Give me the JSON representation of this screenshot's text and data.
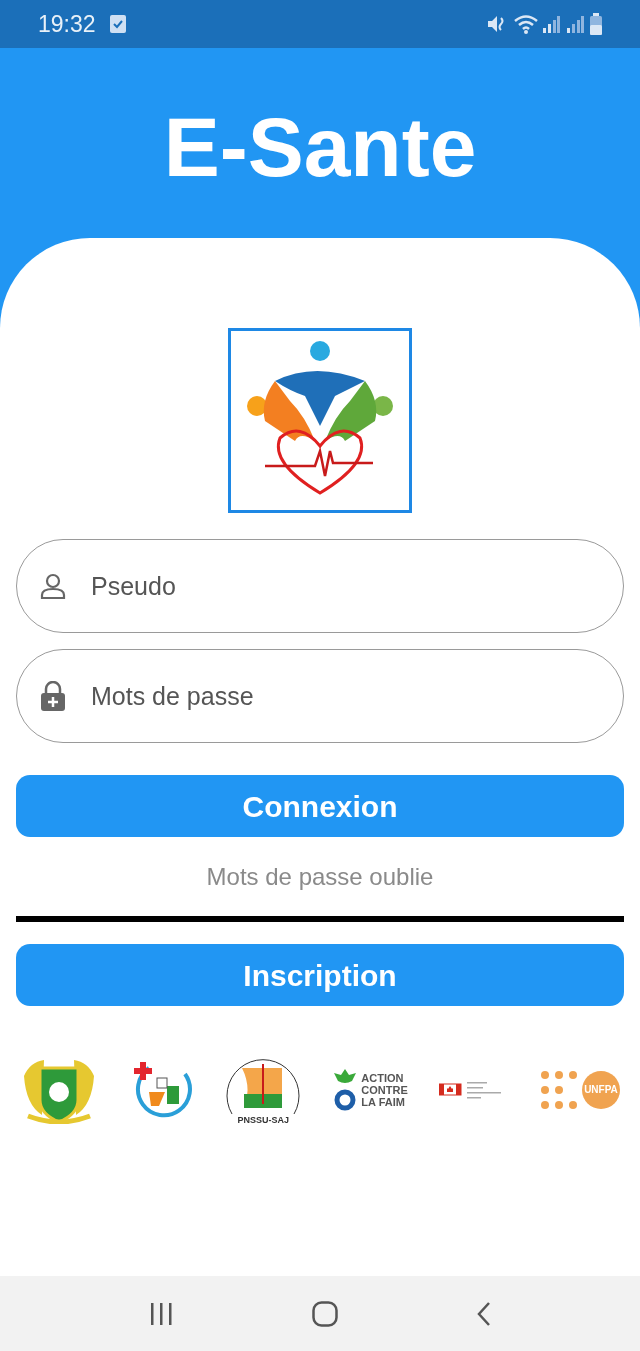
{
  "status_bar": {
    "time": "19:32"
  },
  "app_title": "E-Sante",
  "fields": [
    {
      "kind": "user",
      "placeholder": "Pseudo"
    },
    {
      "kind": "lock",
      "placeholder": "Mots de passe"
    }
  ],
  "login_button": "Connexion",
  "forgot_link": "Mots de passe oublie",
  "signup_button": "Inscription",
  "partners": [
    {
      "kind": "emblem"
    },
    {
      "kind": "ministry"
    },
    {
      "kind": "pnssu",
      "label": "PNSSU-SAJ"
    },
    {
      "kind": "acf",
      "label_lines": [
        "ACTION",
        "CONTRE",
        "LA FAIM"
      ]
    },
    {
      "kind": "canada"
    },
    {
      "kind": "unfpa",
      "label": "UNFPA"
    }
  ]
}
